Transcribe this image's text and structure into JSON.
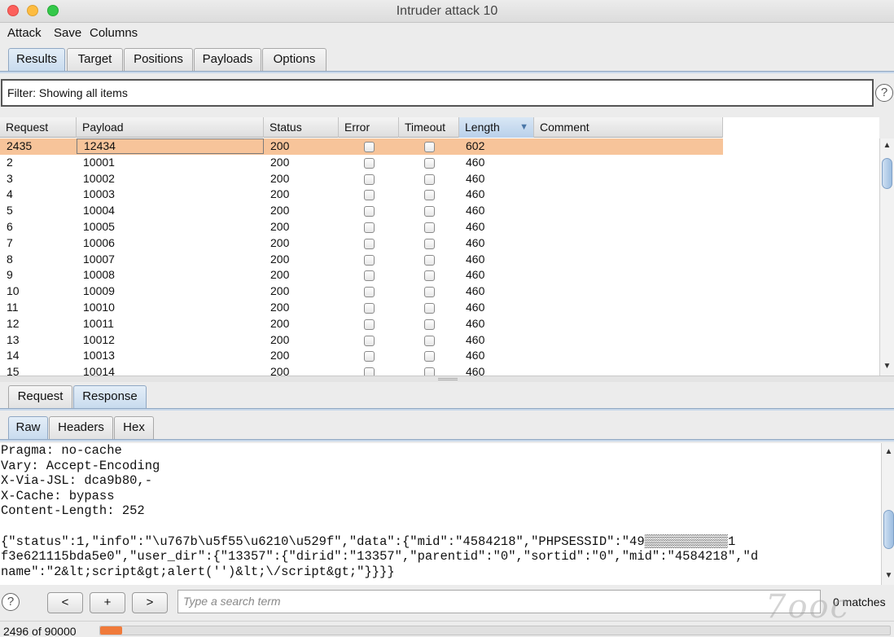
{
  "window": {
    "title": "Intruder attack 10"
  },
  "menu": [
    "Attack",
    "Save",
    "Columns"
  ],
  "main_tabs": [
    {
      "label": "Results",
      "active": true
    },
    {
      "label": "Target",
      "active": false
    },
    {
      "label": "Positions",
      "active": false
    },
    {
      "label": "Payloads",
      "active": false
    },
    {
      "label": "Options",
      "active": false
    }
  ],
  "filter": {
    "text": "Filter: Showing all items",
    "help": "?"
  },
  "table": {
    "columns": [
      "Request",
      "Payload",
      "Status",
      "Error",
      "Timeout",
      "Length",
      "Comment"
    ],
    "sorted_column": "Length",
    "sort_indicator": "▼",
    "rows": [
      {
        "request": "2435",
        "payload": "12434",
        "status": "200",
        "length": "602",
        "selected": true
      },
      {
        "request": "2",
        "payload": "10001",
        "status": "200",
        "length": "460"
      },
      {
        "request": "3",
        "payload": "10002",
        "status": "200",
        "length": "460"
      },
      {
        "request": "4",
        "payload": "10003",
        "status": "200",
        "length": "460"
      },
      {
        "request": "5",
        "payload": "10004",
        "status": "200",
        "length": "460"
      },
      {
        "request": "6",
        "payload": "10005",
        "status": "200",
        "length": "460"
      },
      {
        "request": "7",
        "payload": "10006",
        "status": "200",
        "length": "460"
      },
      {
        "request": "8",
        "payload": "10007",
        "status": "200",
        "length": "460"
      },
      {
        "request": "9",
        "payload": "10008",
        "status": "200",
        "length": "460"
      },
      {
        "request": "10",
        "payload": "10009",
        "status": "200",
        "length": "460"
      },
      {
        "request": "11",
        "payload": "10010",
        "status": "200",
        "length": "460"
      },
      {
        "request": "12",
        "payload": "10011",
        "status": "200",
        "length": "460"
      },
      {
        "request": "13",
        "payload": "10012",
        "status": "200",
        "length": "460"
      },
      {
        "request": "14",
        "payload": "10013",
        "status": "200",
        "length": "460"
      },
      {
        "request": "15",
        "payload": "10014",
        "status": "200",
        "length": "460"
      }
    ]
  },
  "detail_tabs": [
    {
      "label": "Request",
      "active": false
    },
    {
      "label": "Response",
      "active": true
    }
  ],
  "view_tabs": [
    {
      "label": "Raw",
      "active": true
    },
    {
      "label": "Headers",
      "active": false
    },
    {
      "label": "Hex",
      "active": false
    }
  ],
  "response_lines": [
    "Pragma: no-cache",
    "Vary: Accept-Encoding",
    "X-Via-JSL: dca9b80,-",
    "X-Cache: bypass",
    "Content-Length: 252",
    "",
    "{\"status\":1,\"info\":\"\\u767b\\u5f55\\u6210\\u529f\",\"data\":{\"mid\":\"4584218\",\"PHPSESSID\":\"49▒▒▒▒▒▒▒▒▒▒▒1",
    "f3e621115bda5e0\",\"user_dir\":{\"13357\":{\"dirid\":\"13357\",\"parentid\":\"0\",\"sortid\":\"0\",\"mid\":\"4584218\",\"d",
    "name\":\"2&lt;script&gt;alert('')&lt;\\/script&gt;\"}}}}"
  ],
  "search": {
    "help": "?",
    "prev": "<",
    "add": "+",
    "next": ">",
    "placeholder": "Type a search term",
    "matches": "0 matches"
  },
  "progress": {
    "label": "2496 of 90000",
    "fraction": 0.0277
  },
  "watermark": "7ooc"
}
